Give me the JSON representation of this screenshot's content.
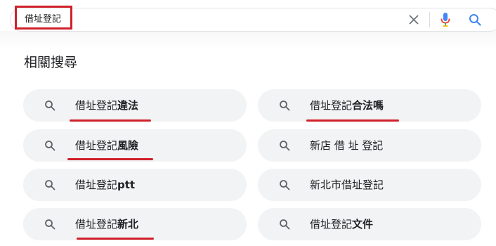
{
  "search": {
    "query": "借址登記"
  },
  "related": {
    "title": "相關搜尋",
    "items": [
      {
        "label": "借址登記違法"
      },
      {
        "label": "借址登記合法嗎"
      },
      {
        "label": "借址登記風險"
      },
      {
        "label": "新店 借 址 登記"
      },
      {
        "label": "借址登記ptt"
      },
      {
        "label": "新北市借址登記"
      },
      {
        "label": "借址登記新北"
      },
      {
        "label": "借址登記文件"
      }
    ]
  },
  "colors": {
    "annotation_red": "#d0202a",
    "chip_background": "#f1f3f4",
    "mic_blue": "#4285f4",
    "mic_red": "#ea4335",
    "search_blue": "#4285f4"
  }
}
